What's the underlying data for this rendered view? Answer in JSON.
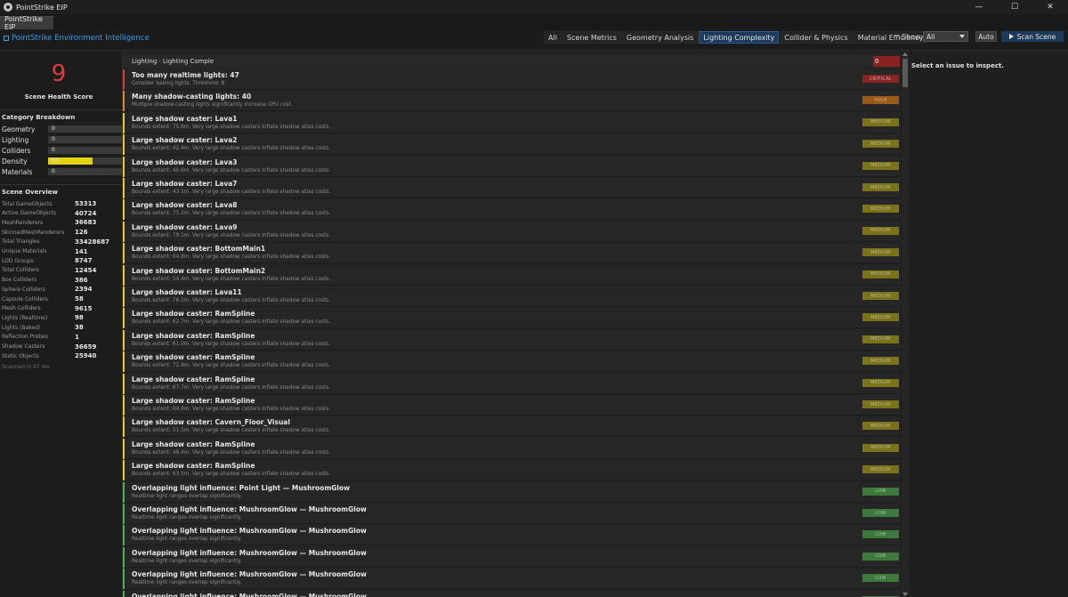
{
  "window": {
    "title": "PointStrike EIP"
  },
  "tab": {
    "label": "PointStrike EIP"
  },
  "header": {
    "brand": "PointStrike  Environment Intelligence",
    "filters": [
      "All",
      "Scene Metrics",
      "Geometry Analysis",
      "Lighting Complexity",
      "Collider & Physics",
      "Material Efficiency"
    ],
    "active_filter": "Lighting Complexity",
    "show_label": "Show:",
    "show_value": "All",
    "auto_label": "Auto",
    "scan_label": "Scan Scene"
  },
  "left": {
    "score": "9",
    "score_label": "Scene Health Score",
    "category_title": "Category Breakdown",
    "categories": [
      {
        "label": "Geometry",
        "value": "0",
        "fill": 0
      },
      {
        "label": "Lighting",
        "value": "0",
        "fill": 0
      },
      {
        "label": "Colliders",
        "value": "0",
        "fill": 0
      },
      {
        "label": "Density",
        "value": "60",
        "fill": 0.6
      },
      {
        "label": "Materials",
        "value": "0",
        "fill": 0
      }
    ],
    "overview_title": "Scene Overview",
    "overview": [
      {
        "k": "Total GameObjects",
        "v": "53313"
      },
      {
        "k": "Active GameObjects",
        "v": "40724"
      },
      {
        "k": "MeshRenderers",
        "v": "36683"
      },
      {
        "k": "SkinnedMeshRenderers",
        "v": "126"
      },
      {
        "k": "Total Triangles",
        "v": "33428687"
      },
      {
        "k": "Unique Materials",
        "v": "141"
      },
      {
        "k": "LOD Groups",
        "v": "8747"
      },
      {
        "k": "Total Colliders",
        "v": "12454"
      },
      {
        "k": "Box Colliders",
        "v": "386"
      },
      {
        "k": "Sphere Colliders",
        "v": "2394"
      },
      {
        "k": "Capsule Colliders",
        "v": "58"
      },
      {
        "k": "Mesh Colliders",
        "v": "9615"
      },
      {
        "k": "Lights (Realtime)",
        "v": "98"
      },
      {
        "k": "Lights (Baked)",
        "v": "38"
      },
      {
        "k": "Reflection Probes",
        "v": "1"
      },
      {
        "k": "Shadow Casters",
        "v": "36659"
      },
      {
        "k": "Static Objects",
        "v": "25940"
      }
    ],
    "scanned": "Scanned in 97 ms"
  },
  "list": {
    "breadcrumb": "Lighting  ·  Lighting Comple",
    "count": "0",
    "issues": [
      {
        "title": "Too many realtime lights: 47",
        "desc": "Consider baking lights. Threshold: 8",
        "severity": "CRITICAL"
      },
      {
        "title": "Many shadow-casting lights: 40",
        "desc": "Multiple shadow-casting lights significantly increase GPU cost.",
        "severity": "HIGH"
      },
      {
        "title": "Large shadow caster: Lava1",
        "desc": "Bounds extent: 75.8m. Very large shadow casters inflate shadow atlas costs.",
        "severity": "MEDIUM"
      },
      {
        "title": "Large shadow caster: Lava2",
        "desc": "Bounds extent: 42.4m. Very large shadow casters inflate shadow atlas costs.",
        "severity": "MEDIUM"
      },
      {
        "title": "Large shadow caster: Lava3",
        "desc": "Bounds extent: 40.6m. Very large shadow casters inflate shadow atlas costs.",
        "severity": "MEDIUM"
      },
      {
        "title": "Large shadow caster: Lava7",
        "desc": "Bounds extent: 43.1m. Very large shadow casters inflate shadow atlas costs.",
        "severity": "MEDIUM"
      },
      {
        "title": "Large shadow caster: Lava8",
        "desc": "Bounds extent: 75.2m. Very large shadow casters inflate shadow atlas costs.",
        "severity": "MEDIUM"
      },
      {
        "title": "Large shadow caster: Lava9",
        "desc": "Bounds extent: 79.1m. Very large shadow casters inflate shadow atlas costs.",
        "severity": "MEDIUM"
      },
      {
        "title": "Large shadow caster: BottomMain1",
        "desc": "Bounds extent: 64.8m. Very large shadow casters inflate shadow atlas costs.",
        "severity": "MEDIUM"
      },
      {
        "title": "Large shadow caster: BottomMain2",
        "desc": "Bounds extent: 54.4m. Very large shadow casters inflate shadow atlas costs.",
        "severity": "MEDIUM"
      },
      {
        "title": "Large shadow caster: Lava11",
        "desc": "Bounds extent: 76.1m. Very large shadow casters inflate shadow atlas costs.",
        "severity": "MEDIUM"
      },
      {
        "title": "Large shadow caster: RamSpline",
        "desc": "Bounds extent: 62.7m. Very large shadow casters inflate shadow atlas costs.",
        "severity": "MEDIUM"
      },
      {
        "title": "Large shadow caster: RamSpline",
        "desc": "Bounds extent: 61.0m. Very large shadow casters inflate shadow atlas costs.",
        "severity": "MEDIUM"
      },
      {
        "title": "Large shadow caster: RamSpline",
        "desc": "Bounds extent: 72.4m. Very large shadow casters inflate shadow atlas costs.",
        "severity": "MEDIUM"
      },
      {
        "title": "Large shadow caster: RamSpline",
        "desc": "Bounds extent: 67.7m. Very large shadow casters inflate shadow atlas costs.",
        "severity": "MEDIUM"
      },
      {
        "title": "Large shadow caster: RamSpline",
        "desc": "Bounds extent: 64.8m. Very large shadow casters inflate shadow atlas costs.",
        "severity": "MEDIUM"
      },
      {
        "title": "Large shadow caster: Cavern_Floor_Visual",
        "desc": "Bounds extent: 51.5m. Very large shadow casters inflate shadow atlas costs.",
        "severity": "MEDIUM"
      },
      {
        "title": "Large shadow caster: RamSpline",
        "desc": "Bounds extent: 48.4m. Very large shadow casters inflate shadow atlas costs.",
        "severity": "MEDIUM"
      },
      {
        "title": "Large shadow caster: RamSpline",
        "desc": "Bounds extent: 63.5m. Very large shadow casters inflate shadow atlas costs.",
        "severity": "MEDIUM"
      },
      {
        "title": "Overlapping light influence: Point Light — MushroomGlow",
        "desc": "Realtime light ranges overlap significantly.",
        "severity": "LOW"
      },
      {
        "title": "Overlapping light influence: MushroomGlow — MushroomGlow",
        "desc": "Realtime light ranges overlap significantly.",
        "severity": "LOW"
      },
      {
        "title": "Overlapping light influence: MushroomGlow — MushroomGlow",
        "desc": "Realtime light ranges overlap significantly.",
        "severity": "LOW"
      },
      {
        "title": "Overlapping light influence: MushroomGlow — MushroomGlow",
        "desc": "Realtime light ranges overlap significantly.",
        "severity": "LOW"
      },
      {
        "title": "Overlapping light influence: MushroomGlow — MushroomGlow",
        "desc": "Realtime light ranges overlap significantly.",
        "severity": "LOW"
      },
      {
        "title": "Overlapping light influence: MushroomGlow — MushroomGlow",
        "desc": "Realtime light ranges overlap significantly.",
        "severity": "LOW"
      }
    ]
  },
  "severity_colors": {
    "CRITICAL": {
      "strip": "#d33a3a",
      "badge": "#8a2424"
    },
    "HIGH": {
      "strip": "#e0832a",
      "badge": "#9a5a1a"
    },
    "MEDIUM": {
      "strip": "#e3c82a",
      "badge": "#7a7318"
    },
    "LOW": {
      "strip": "#4caf50",
      "badge": "#3c7a3c"
    }
  },
  "details": {
    "hint": "Select an issue to inspect."
  }
}
